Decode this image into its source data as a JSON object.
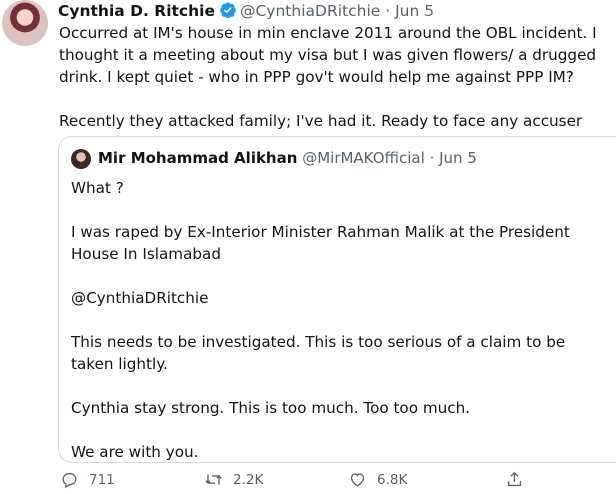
{
  "tweet": {
    "author_name": "Cynthia D. Ritchie",
    "handle": "@CynthiaDRitchie",
    "separator": "·",
    "date": "Jun 5",
    "text": "Occurred at IM's house in min enclave 2011 around the OBL incident. I thought it a meeting about my visa but I was given flowers/ a drugged drink. I kept quiet - who in PPP gov't would help me against PPP IM?\n\nRecently they attacked family; I've had it. Ready to face any accuser"
  },
  "quoted_tweet": {
    "author_name": "Mir Mohammad Alikhan",
    "handle": "@MirMAKOfficial",
    "separator": "·",
    "date": "Jun 5",
    "text": "What ?\n\nI was raped by Ex-Interior Minister Rahman Malik at the President House In Islamabad\n\n@CynthiaDRitchie\n\nThis needs to be investigated. This is too serious of a claim to be taken lightly.\n\nCynthia stay strong. This is too much. Too too much.\n\nWe are with you."
  },
  "actions": {
    "reply_count": "711",
    "retweet_count": "2.2K",
    "like_count": "6.8K"
  },
  "colors": {
    "verified": "#1d9bf0",
    "muted": "#536471",
    "border": "#cfd9de"
  },
  "icons": [
    "verified-badge-icon",
    "reply-icon",
    "retweet-icon",
    "like-icon",
    "share-icon"
  ]
}
